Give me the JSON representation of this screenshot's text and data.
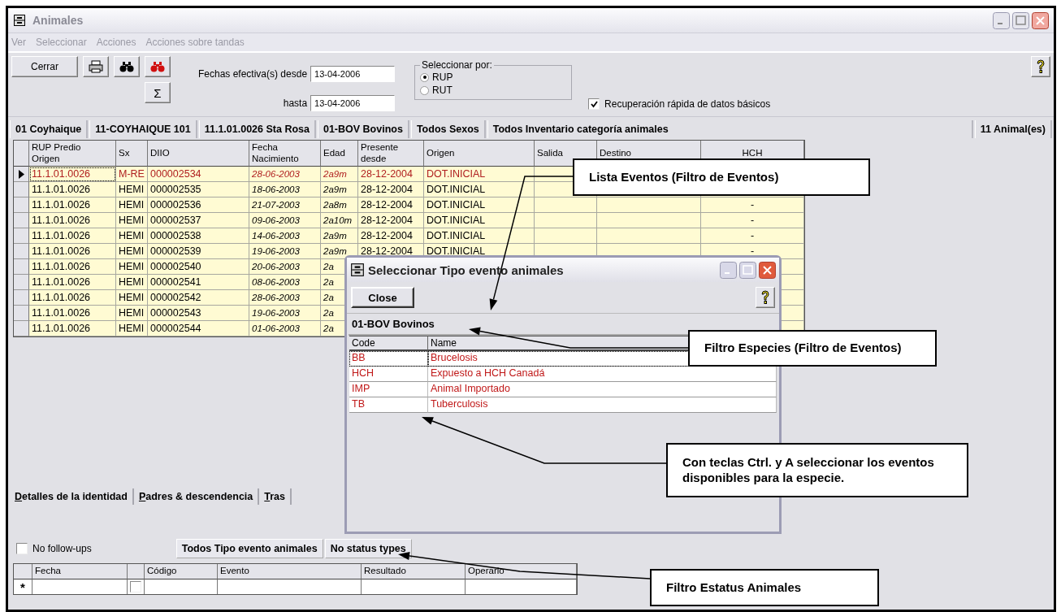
{
  "window": {
    "title": "Animales"
  },
  "menu": [
    "Ver",
    "Seleccionar",
    "Acciones",
    "Acciones sobre tandas"
  ],
  "toolbar": {
    "close_button": "Cerrar",
    "sum_button": "Σ",
    "date_from_label": "Fechas efectiva(s) desde",
    "date_from": "13-04-2006",
    "date_to_label": "hasta",
    "date_to": "13-04-2006",
    "select_by": {
      "legend": "Seleccionar por:",
      "options": [
        {
          "label": "RUP",
          "selected": true
        },
        {
          "label": "RUT",
          "selected": false
        }
      ]
    },
    "quick_retrieval": {
      "label": "Recuperación rápida de datos básicos",
      "checked": true
    }
  },
  "filter_bar": [
    "01 Coyhaique",
    "11-COYHAIQUE 101",
    "11.1.01.0026 Sta Rosa",
    "01-BOV Bovinos",
    "Todos Sexos",
    "Todos Inventario categoría animales"
  ],
  "animal_count": "11 Animal(es)",
  "grid": {
    "columns": [
      "RUP Predio\nOrigen",
      "Sx",
      "DIIO",
      "Fecha\nNacimiento",
      "Edad",
      "Presente\ndesde",
      "Origen",
      "Salida",
      "Destino",
      "HCH"
    ],
    "rows": [
      {
        "selected": true,
        "rup": "11.1.01.0026",
        "sx": "M-RE",
        "diio": "000002534",
        "fecha": "28-06-2003",
        "edad": "2a9m",
        "presente": "28-12-2004",
        "origen": "DOT.INICIAL"
      },
      {
        "selected": false,
        "rup": "11.1.01.0026",
        "sx": "HEMI",
        "diio": "000002535",
        "fecha": "18-06-2003",
        "edad": "2a9m",
        "presente": "28-12-2004",
        "origen": "DOT.INICIAL"
      },
      {
        "selected": false,
        "rup": "11.1.01.0026",
        "sx": "HEMI",
        "diio": "000002536",
        "fecha": "21-07-2003",
        "edad": "2a8m",
        "presente": "28-12-2004",
        "origen": "DOT.INICIAL",
        "hch": "-"
      },
      {
        "selected": false,
        "rup": "11.1.01.0026",
        "sx": "HEMI",
        "diio": "000002537",
        "fecha": "09-06-2003",
        "edad": "2a10m",
        "presente": "28-12-2004",
        "origen": "DOT.INICIAL",
        "hch": "-"
      },
      {
        "selected": false,
        "rup": "11.1.01.0026",
        "sx": "HEMI",
        "diio": "000002538",
        "fecha": "14-06-2003",
        "edad": "2a9m",
        "presente": "28-12-2004",
        "origen": "DOT.INICIAL",
        "hch": "-"
      },
      {
        "selected": false,
        "rup": "11.1.01.0026",
        "sx": "HEMI",
        "diio": "000002539",
        "fecha": "19-06-2003",
        "edad": "2a9m",
        "presente": "28-12-2004",
        "origen": "DOT.INICIAL",
        "hch": "-"
      },
      {
        "selected": false,
        "rup": "11.1.01.0026",
        "sx": "HEMI",
        "diio": "000002540",
        "fecha": "20-06-2003",
        "edad": "2a"
      },
      {
        "selected": false,
        "rup": "11.1.01.0026",
        "sx": "HEMI",
        "diio": "000002541",
        "fecha": "08-06-2003",
        "edad": "2a"
      },
      {
        "selected": false,
        "rup": "11.1.01.0026",
        "sx": "HEMI",
        "diio": "000002542",
        "fecha": "28-06-2003",
        "edad": "2a"
      },
      {
        "selected": false,
        "rup": "11.1.01.0026",
        "sx": "HEMI",
        "diio": "000002543",
        "fecha": "19-06-2003",
        "edad": "2a"
      },
      {
        "selected": false,
        "rup": "11.1.01.0026",
        "sx": "HEMI",
        "diio": "000002544",
        "fecha": "01-06-2003",
        "edad": "2a"
      }
    ]
  },
  "detail_tabs": [
    "Detalles de la identidad",
    "Padres & descendencia",
    "Tras"
  ],
  "no_follow_ups": {
    "label": "No follow-ups",
    "checked": false
  },
  "status_chips": [
    "Todos Tipo evento animales",
    "No status types"
  ],
  "events_grid": {
    "columns": [
      "Fecha",
      "Código",
      "Evento",
      "Resultado",
      "Operario"
    ],
    "new_row_marker": "*",
    "new_row_checked": false
  },
  "dialog": {
    "title": "Seleccionar Tipo evento animales",
    "close_button": "Close",
    "species": "01-BOV Bovinos",
    "columns": [
      "Code",
      "Name"
    ],
    "rows": [
      {
        "code": "BB",
        "name": "Brucelosis",
        "selected": true
      },
      {
        "code": "HCH",
        "name": "Expuesto a HCH Canadá",
        "selected": false
      },
      {
        "code": "IMP",
        "name": "Animal Importado",
        "selected": false
      },
      {
        "code": "TB",
        "name": "Tuberculosis",
        "selected": false
      }
    ]
  },
  "callouts": [
    "Lista Eventos (Filtro de Eventos)",
    "Filtro Especies (Filtro de Eventos)",
    "Con teclas Ctrl. y A seleccionar los eventos disponibles para la especie.",
    "Filtro Estatus Animales"
  ]
}
